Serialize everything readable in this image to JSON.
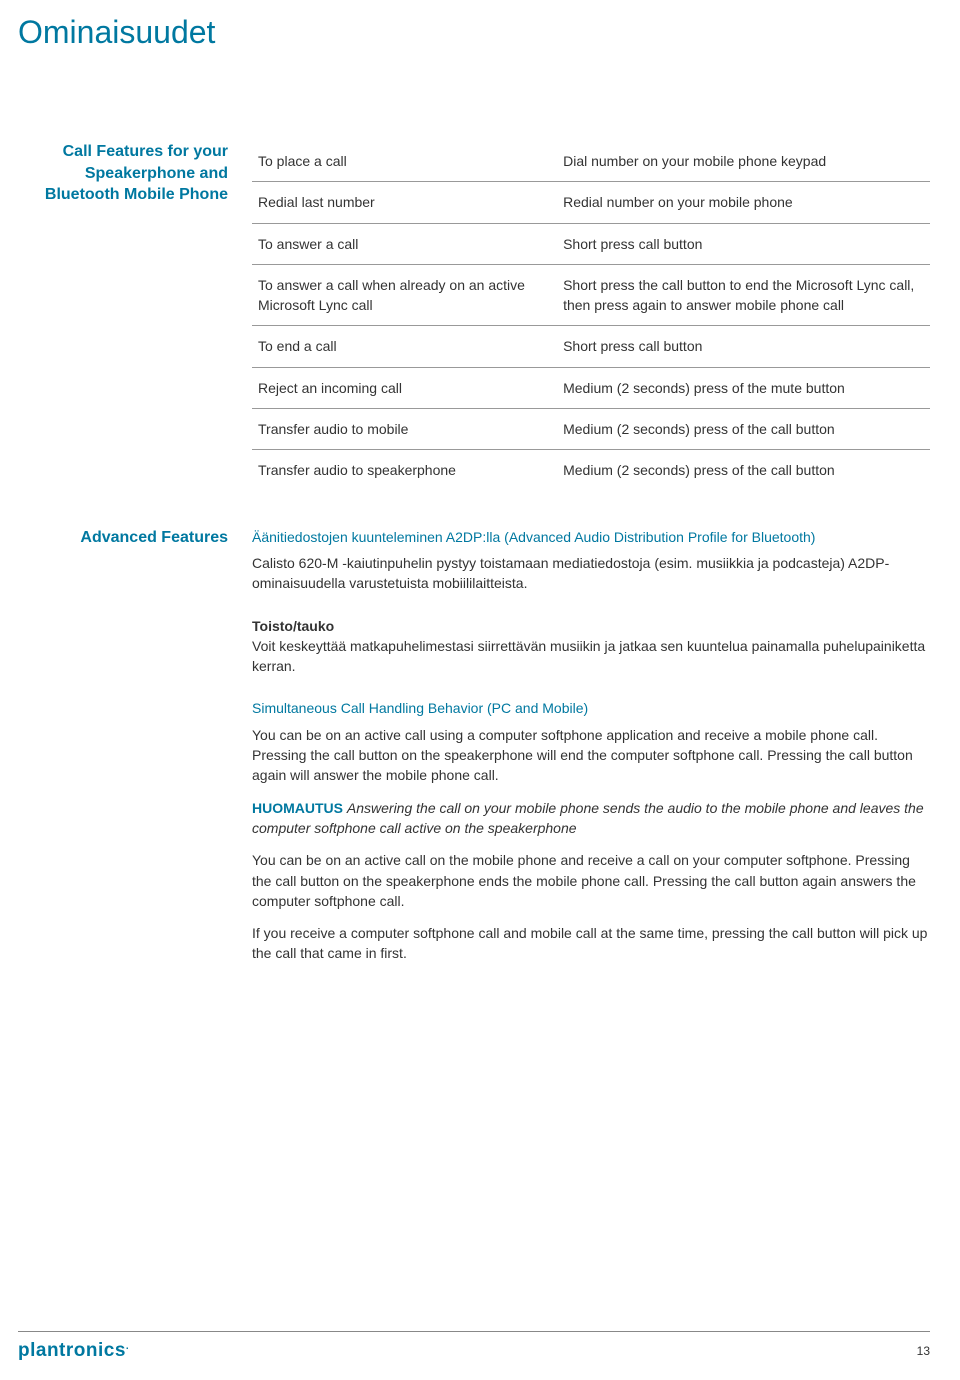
{
  "title": "Ominaisuudet",
  "features_heading": "Call Features for your Speakerphone and Bluetooth Mobile Phone",
  "features_table": [
    {
      "action": "To place a call",
      "result": "Dial number on your mobile phone keypad"
    },
    {
      "action": "Redial last number",
      "result": "Redial number on your mobile phone"
    },
    {
      "action": "To answer a call",
      "result": "Short press call button"
    },
    {
      "action": "To answer a call when already on an active Microsoft Lync call",
      "result": "Short press the call button to end the Microsoft Lync call, then press again to answer mobile phone call"
    },
    {
      "action": "To end a call",
      "result": "Short press call button"
    },
    {
      "action": "Reject an incoming call",
      "result": "Medium (2 seconds) press of the mute button"
    },
    {
      "action": "Transfer audio to mobile",
      "result": "Medium (2 seconds) press of the call button"
    },
    {
      "action": "Transfer audio to speakerphone",
      "result": "Medium (2 seconds) press of the call button"
    }
  ],
  "advanced_heading": "Advanced Features",
  "a2dp_heading": "Äänitiedostojen kuunteleminen A2DP:lla (Advanced Audio Distribution Profile for Bluetooth)",
  "a2dp_desc": "Calisto 620-M -kaiutinpuhelin pystyy toistamaan mediatiedostoja (esim. musiikkia ja podcasteja) A2DP-ominaisuudella varustetuista mobiililaitteista.",
  "playpause_heading": "Toisto/tauko",
  "playpause_desc": "Voit keskeyttää matkapuhelimestasi siirrettävän musiikin ja jatkaa sen kuuntelua painamalla puhelupainiketta kerran.",
  "sim_heading": "Simultaneous Call Handling Behavior (PC and Mobile)",
  "sim_p1": "You can be on an active call using a computer softphone application and receive a mobile phone call. Pressing the call button on the speakerphone will end the computer softphone call. Pressing the call button again will answer the mobile phone call.",
  "note_label": "HUOMAUTUS",
  "note_text": "Answering the call on your mobile phone sends the audio to the mobile phone and leaves the computer softphone call active on the speakerphone",
  "sim_p2": "You can be on an active call on the mobile phone and receive a call on your computer softphone. Pressing the call button on the speakerphone ends the mobile phone call. Pressing the call button again answers the computer softphone call.",
  "sim_p3": "If you receive a computer softphone call and mobile call at the same time, pressing the call button will pick up the call that came in first.",
  "brand": "plantronics",
  "page_number": "13"
}
